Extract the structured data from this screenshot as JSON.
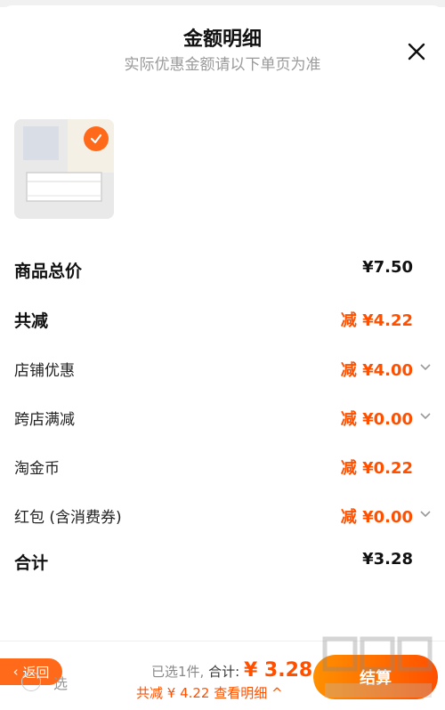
{
  "header": {
    "title": "金额明细",
    "subtitle": "实际优惠金额请以下单页为准"
  },
  "rows": [
    {
      "label": "商品总价",
      "value": "¥7.50",
      "style": "black-strong"
    },
    {
      "label": "共减",
      "value": "减 ¥4.22",
      "style": "orange-strong"
    },
    {
      "label": "店铺优惠",
      "value": "减 ¥4.00",
      "style": "orange",
      "chevron": true
    },
    {
      "label": "跨店满减",
      "value": "减 ¥0.00",
      "style": "orange",
      "chevron": true
    },
    {
      "label": "淘金币",
      "value": "减 ¥0.22",
      "style": "orange",
      "chevron": false
    },
    {
      "label": "红包 (含消费券)",
      "value": "减 ¥0.00",
      "style": "orange",
      "chevron": true
    },
    {
      "label": "合计",
      "value": "¥3.28",
      "style": "black-strong"
    }
  ],
  "footer": {
    "back_label": "返回",
    "select_all_label": "选",
    "selected_text": "已选1件,",
    "total_label": "合计:",
    "total_value": "¥ 3.28",
    "reduce_text": "共减 ¥ 4.22",
    "details_link": "查看明细 ^",
    "settle_label": "结算"
  },
  "colors": {
    "accent": "#ff5000",
    "accent_light": "#ff6a1a"
  }
}
